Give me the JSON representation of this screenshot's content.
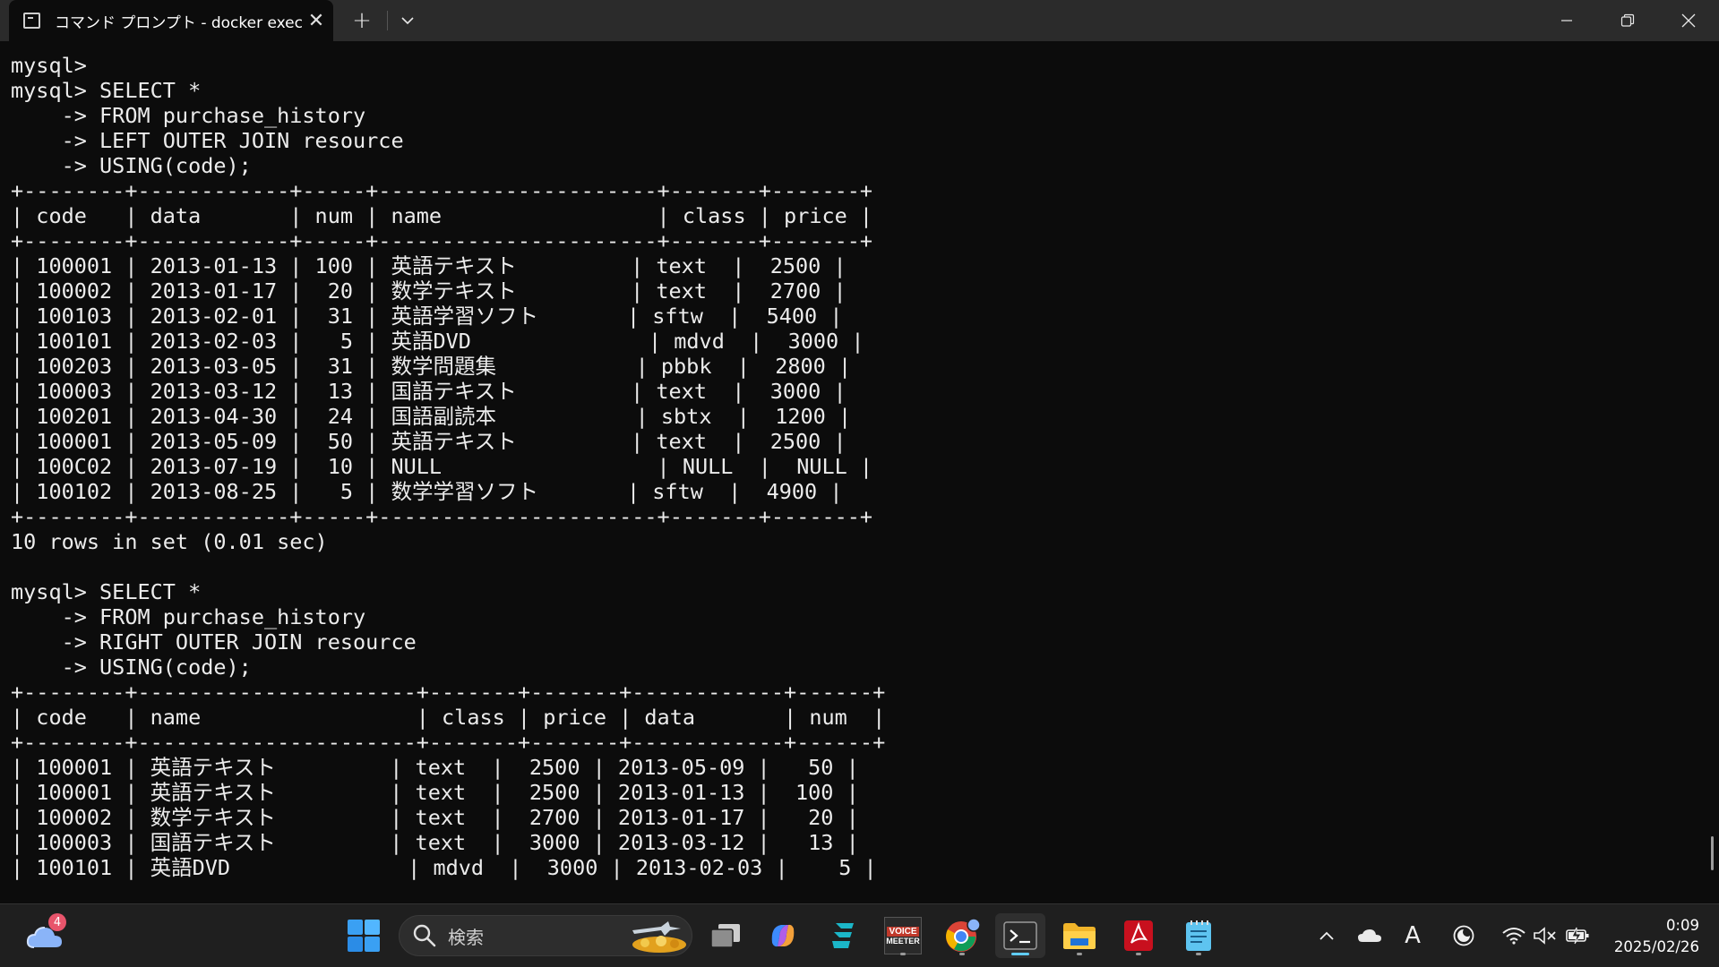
{
  "window": {
    "tab_title": "コマンド プロンプト - docker  exec",
    "tab_close": "✕",
    "new_tab": "+",
    "dropdown": "⌄",
    "minimize": "—",
    "maximize": "❐",
    "close": "✕"
  },
  "terminal": {
    "lines": [
      "mysql>",
      "mysql> SELECT *",
      "    -> FROM purchase_history",
      "    -> LEFT OUTER JOIN resource",
      "    -> USING(code);",
      "+--------+------------+-----+----------------------+-------+-------+",
      "| code   | data       | num | name                 | class | price |",
      "+--------+------------+-----+----------------------+-------+-------+",
      "| 100001 | 2013-01-13 | 100 | 英語テキスト         | text  |  2500 |",
      "| 100002 | 2013-01-17 |  20 | 数学テキスト         | text  |  2700 |",
      "| 100103 | 2013-02-01 |  31 | 英語学習ソフト       | sftw  |  5400 |",
      "| 100101 | 2013-02-03 |   5 | 英語DVD              | mdvd  |  3000 |",
      "| 100203 | 2013-03-05 |  31 | 数学問題集           | pbbk  |  2800 |",
      "| 100003 | 2013-03-12 |  13 | 国語テキスト         | text  |  3000 |",
      "| 100201 | 2013-04-30 |  24 | 国語副読本           | sbtx  |  1200 |",
      "| 100001 | 2013-05-09 |  50 | 英語テキスト         | text  |  2500 |",
      "| 100C02 | 2013-07-19 |  10 | NULL                 | NULL  |  NULL |",
      "| 100102 | 2013-08-25 |   5 | 数学学習ソフト       | sftw  |  4900 |",
      "+--------+------------+-----+----------------------+-------+-------+",
      "10 rows in set (0.01 sec)",
      "",
      "mysql> SELECT *",
      "    -> FROM purchase_history",
      "    -> RIGHT OUTER JOIN resource",
      "    -> USING(code);",
      "+--------+----------------------+-------+-------+------------+------+",
      "| code   | name                 | class | price | data       | num  |",
      "+--------+----------------------+-------+-------+------------+------+",
      "| 100001 | 英語テキスト         | text  |  2500 | 2013-05-09 |   50 |",
      "| 100001 | 英語テキスト         | text  |  2500 | 2013-01-13 |  100 |",
      "| 100002 | 数学テキスト         | text  |  2700 | 2013-01-17 |   20 |",
      "| 100003 | 国語テキスト         | text  |  3000 | 2013-03-12 |   13 |",
      "| 100101 | 英語DVD              | mdvd  |  3000 | 2013-02-03 |    5 |"
    ]
  },
  "taskbar": {
    "weather_badge": "4",
    "search_icon": "search-icon",
    "search_placeholder": "検索",
    "voicemeeter_label_1": "VOICE",
    "voicemeeter_label_2": "MEETER",
    "tray_chevron": "^",
    "ime_mode": "A",
    "time": "0:09",
    "date": "2025/02/26",
    "accent_color": "#60cdff"
  }
}
